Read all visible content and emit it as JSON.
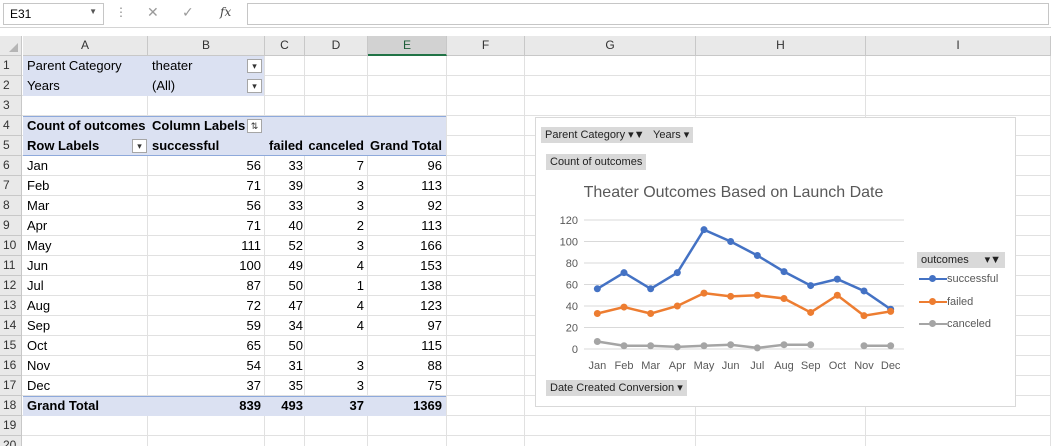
{
  "formula_bar": {
    "name_box": "E31",
    "fx_label": "fx",
    "value": ""
  },
  "columns": [
    "A",
    "B",
    "C",
    "D",
    "E",
    "F",
    "G",
    "H",
    "I"
  ],
  "rows": [
    "1",
    "2",
    "3",
    "4",
    "5",
    "6",
    "7",
    "8",
    "9",
    "10",
    "11",
    "12",
    "13",
    "14",
    "15",
    "16",
    "17",
    "18",
    "19",
    "20"
  ],
  "filters": {
    "parent_label": "Parent Category",
    "parent_value": "theater",
    "years_label": "Years",
    "years_value": "(All)"
  },
  "pivot": {
    "corner_label": "Count of outcomes",
    "column_labels": "Column Labels",
    "row_labels": "Row Labels",
    "headers": [
      "successful",
      "failed",
      "canceled",
      "Grand Total"
    ],
    "rows": [
      {
        "month": "Jan",
        "successful": "56",
        "failed": "33",
        "canceled": "7",
        "total": "96"
      },
      {
        "month": "Feb",
        "successful": "71",
        "failed": "39",
        "canceled": "3",
        "total": "113"
      },
      {
        "month": "Mar",
        "successful": "56",
        "failed": "33",
        "canceled": "3",
        "total": "92"
      },
      {
        "month": "Apr",
        "successful": "71",
        "failed": "40",
        "canceled": "2",
        "total": "113"
      },
      {
        "month": "May",
        "successful": "111",
        "failed": "52",
        "canceled": "3",
        "total": "166"
      },
      {
        "month": "Jun",
        "successful": "100",
        "failed": "49",
        "canceled": "4",
        "total": "153"
      },
      {
        "month": "Jul",
        "successful": "87",
        "failed": "50",
        "canceled": "1",
        "total": "138"
      },
      {
        "month": "Aug",
        "successful": "72",
        "failed": "47",
        "canceled": "4",
        "total": "123"
      },
      {
        "month": "Sep",
        "successful": "59",
        "failed": "34",
        "canceled": "4",
        "total": "97"
      },
      {
        "month": "Oct",
        "successful": "65",
        "failed": "50",
        "canceled": "",
        "total": "115"
      },
      {
        "month": "Nov",
        "successful": "54",
        "failed": "31",
        "canceled": "3",
        "total": "88"
      },
      {
        "month": "Dec",
        "successful": "37",
        "failed": "35",
        "canceled": "3",
        "total": "75"
      }
    ],
    "grand_total": {
      "label": "Grand Total",
      "successful": "839",
      "failed": "493",
      "canceled": "37",
      "total": "1369"
    }
  },
  "chart_buttons": {
    "parent_category": "Parent Category",
    "years": "Years",
    "count": "Count of outcomes",
    "date": "Date Created Conversion",
    "legend_title": "outcomes"
  },
  "chart_data": {
    "type": "line",
    "title": "Theater Outcomes Based on Launch Date",
    "categories": [
      "Jan",
      "Feb",
      "Mar",
      "Apr",
      "May",
      "Jun",
      "Jul",
      "Aug",
      "Sep",
      "Oct",
      "Nov",
      "Dec"
    ],
    "ylim": [
      0,
      120
    ],
    "yticks": [
      0,
      20,
      40,
      60,
      80,
      100,
      120
    ],
    "grid": true,
    "legend_position": "right",
    "series": [
      {
        "name": "successful",
        "color": "#4472c4",
        "values": [
          56,
          71,
          56,
          71,
          111,
          100,
          87,
          72,
          59,
          65,
          54,
          37
        ]
      },
      {
        "name": "failed",
        "color": "#ed7d31",
        "values": [
          33,
          39,
          33,
          40,
          52,
          49,
          50,
          47,
          34,
          50,
          31,
          35
        ]
      },
      {
        "name": "canceled",
        "color": "#a5a5a5",
        "values": [
          7,
          3,
          3,
          2,
          3,
          4,
          1,
          4,
          4,
          null,
          3,
          3
        ]
      }
    ]
  }
}
